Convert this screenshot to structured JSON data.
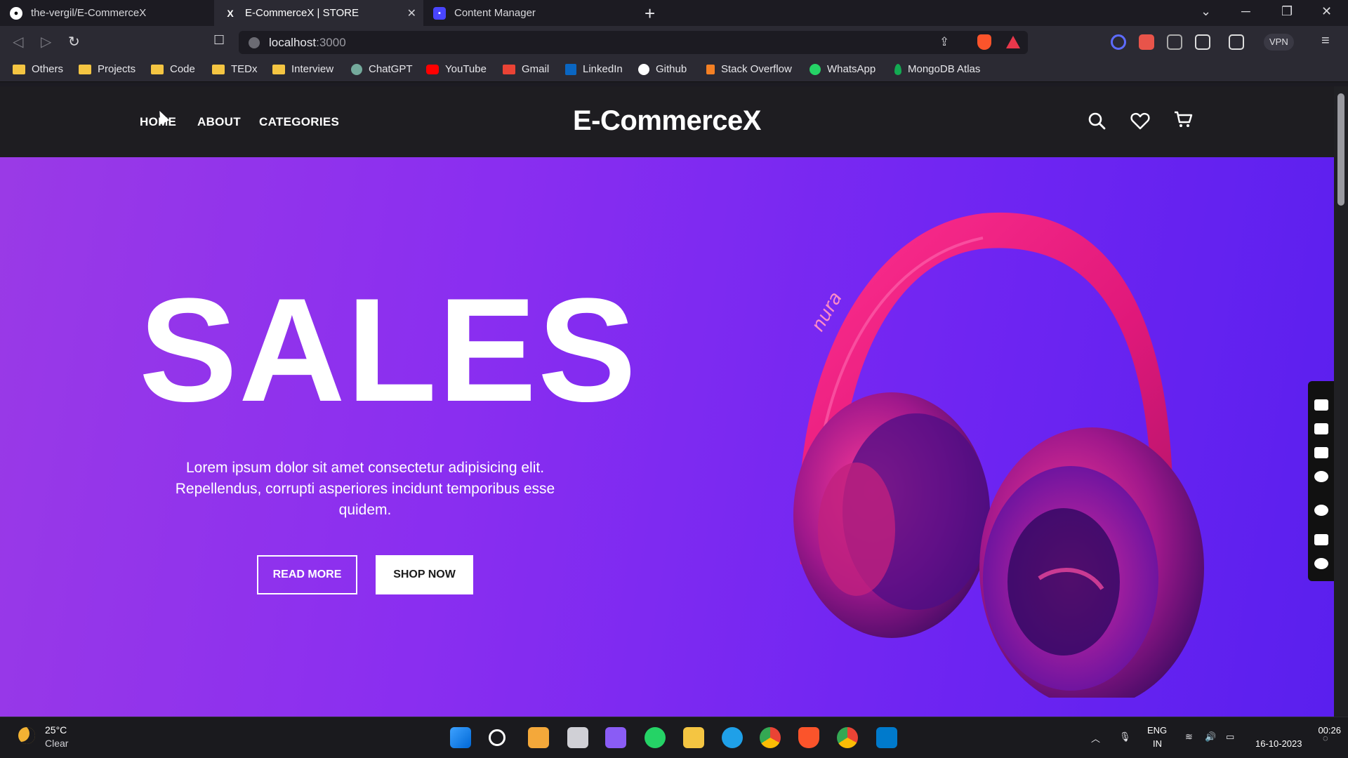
{
  "browser": {
    "tabs": [
      {
        "title": "the-vergil/E-CommerceX",
        "active": false
      },
      {
        "title": "E-CommerceX | STORE",
        "active": true
      },
      {
        "title": "Content Manager",
        "active": false
      }
    ],
    "url_host": "localhost",
    "url_port": ":3000",
    "vpn_label": "VPN",
    "bookmarks": [
      {
        "label": "Others",
        "icon": "folder-icon"
      },
      {
        "label": "Projects",
        "icon": "folder-icon"
      },
      {
        "label": "Code",
        "icon": "folder-icon"
      },
      {
        "label": "TEDx",
        "icon": "folder-icon"
      },
      {
        "label": "Interview",
        "icon": "folder-icon"
      },
      {
        "label": "ChatGPT",
        "icon": "chatgpt-icon"
      },
      {
        "label": "YouTube",
        "icon": "youtube-icon"
      },
      {
        "label": "Gmail",
        "icon": "gmail-icon"
      },
      {
        "label": "LinkedIn",
        "icon": "linkedin-icon"
      },
      {
        "label": "Github",
        "icon": "github-icon"
      },
      {
        "label": "Stack Overflow",
        "icon": "stackoverflow-icon"
      },
      {
        "label": "WhatsApp",
        "icon": "whatsapp-icon"
      },
      {
        "label": "MongoDB Atlas",
        "icon": "mongodb-icon"
      }
    ]
  },
  "site": {
    "nav": {
      "home": "HOME",
      "about": "ABOUT",
      "categories": "CATEGORIES"
    },
    "logo": "E-CommerceX",
    "hero": {
      "title": "SALES",
      "description_line1": "Lorem ipsum dolor sit amet consectetur adipisicing elit.",
      "description_line2": "Repellendus, corrupti asperiores incidunt temporibus esse",
      "description_line3": "quidem.",
      "read_more": "READ MORE",
      "shop_now": "SHOP NOW",
      "product_brand": "nura"
    },
    "colors": {
      "hero_start": "#9a3ae6",
      "hero_end": "#5a1fee",
      "header_bg": "#1e1d21"
    }
  },
  "taskbar": {
    "weather_temp": "25°C",
    "weather_cond": "Clear",
    "lang": "ENG",
    "region": "IN",
    "time": "00:26",
    "date": "16-10-2023"
  }
}
